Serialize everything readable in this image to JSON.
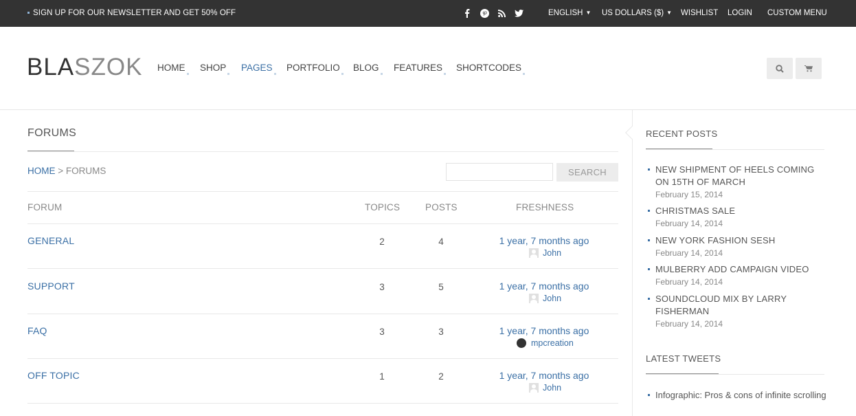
{
  "topbar": {
    "promo": "SIGN UP FOR OUR NEWSLETTER AND GET 50% OFF",
    "social_icons": [
      "facebook-icon",
      "pinterest-icon",
      "rss-icon",
      "twitter-icon"
    ],
    "language": "ENGLISH",
    "currency": "US DOLLARS ($)",
    "wishlist": "WISHLIST",
    "login": "LOGIN",
    "custom_menu": "CUSTOM MENU"
  },
  "header": {
    "logo_part1": "BLA",
    "logo_part2": "SZOK",
    "nav": [
      "HOME",
      "SHOP",
      "PAGES",
      "PORTFOLIO",
      "BLOG",
      "FEATURES",
      "SHORTCODES"
    ],
    "active_nav": "PAGES",
    "icons": [
      "search-icon",
      "cart-icon"
    ]
  },
  "main": {
    "title": "FORUMS",
    "breadcrumb": {
      "home": "HOME",
      "separator": ">",
      "current": "FORUMS"
    },
    "search": {
      "placeholder": "",
      "button": "SEARCH"
    },
    "columns": {
      "forum": "FORUM",
      "topics": "TOPICS",
      "posts": "POSTS",
      "freshness": "FRESHNESS"
    },
    "forums": [
      {
        "name": "GENERAL",
        "topics": "2",
        "posts": "4",
        "freshness": "1 year, 7 months ago",
        "author": "John",
        "avatar": "default"
      },
      {
        "name": "SUPPORT",
        "topics": "3",
        "posts": "5",
        "freshness": "1 year, 7 months ago",
        "author": "John",
        "avatar": "default"
      },
      {
        "name": "FAQ",
        "topics": "3",
        "posts": "3",
        "freshness": "1 year, 7 months ago",
        "author": "mpcreation",
        "avatar": "custom"
      },
      {
        "name": "OFF TOPIC",
        "topics": "1",
        "posts": "2",
        "freshness": "1 year, 7 months ago",
        "author": "John",
        "avatar": "default"
      }
    ]
  },
  "sidebar": {
    "recent_posts_title": "RECENT POSTS",
    "recent_posts": [
      {
        "title": "NEW SHIPMENT OF HEELS COMING ON 15TH OF MARCH",
        "date": "February 15, 2014"
      },
      {
        "title": "CHRISTMAS SALE",
        "date": "February 14, 2014"
      },
      {
        "title": "NEW YORK FASHION SESH",
        "date": "February 14, 2014"
      },
      {
        "title": "MULBERRY ADD CAMPAIGN VIDEO",
        "date": "February 14, 2014"
      },
      {
        "title": "SOUNDCLOUD MIX BY LARRY FISHERMAN",
        "date": "February 14, 2014"
      }
    ],
    "latest_tweets_title": "LATEST TWEETS",
    "tweets": [
      "Infographic: Pros & cons of infinite scrolling"
    ]
  },
  "colors": {
    "topbar_bg": "#333333",
    "link": "#3a6fa5",
    "button_bg": "#ececec"
  }
}
